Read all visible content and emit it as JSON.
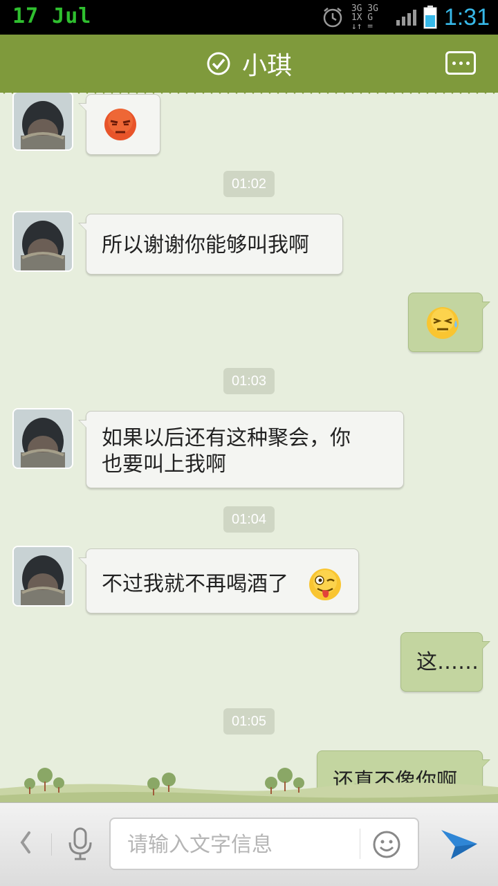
{
  "status_bar": {
    "date": "17 Jul",
    "time": "1:31",
    "network_top": "3G 3G 1X G",
    "network_bottom": "↓↑ ="
  },
  "header": {
    "title": "小琪",
    "online_icon": "check-circle-icon",
    "more_icon": "more-dots-icon"
  },
  "messages": [
    {
      "side": "left",
      "type": "emoji",
      "emoji": "angry-face-icon"
    },
    {
      "type": "timestamp",
      "text": "01:02"
    },
    {
      "side": "left",
      "type": "text",
      "text": "所以谢谢你能够叫我啊"
    },
    {
      "side": "right",
      "type": "emoji",
      "emoji": "sweat-face-icon"
    },
    {
      "type": "timestamp",
      "text": "01:03"
    },
    {
      "side": "left",
      "type": "text",
      "line1": "如果以后还有这种聚会，你",
      "line2": "也要叫上我啊"
    },
    {
      "type": "timestamp",
      "text": "01:04"
    },
    {
      "side": "left",
      "type": "text_emoji",
      "text": "不过我就不再喝酒了",
      "emoji": "wink-tongue-face-icon"
    },
    {
      "side": "right",
      "type": "text",
      "text": "这……"
    },
    {
      "type": "timestamp",
      "text": "01:05"
    },
    {
      "side": "right",
      "type": "text",
      "text": "还真不像你啊"
    }
  ],
  "input_bar": {
    "placeholder": "请输入文字信息",
    "back_icon": "chevron-left-icon",
    "mic_icon": "microphone-icon",
    "emoji_icon": "smiley-icon",
    "send_icon": "send-arrow-icon"
  },
  "colors": {
    "header": "#7f9a3c",
    "background": "#e7eedd",
    "left_bubble": "#f4f5f2",
    "right_bubble": "#c3d5a0",
    "time_accent": "#37b8e8",
    "date_accent": "#2fbf2f"
  }
}
